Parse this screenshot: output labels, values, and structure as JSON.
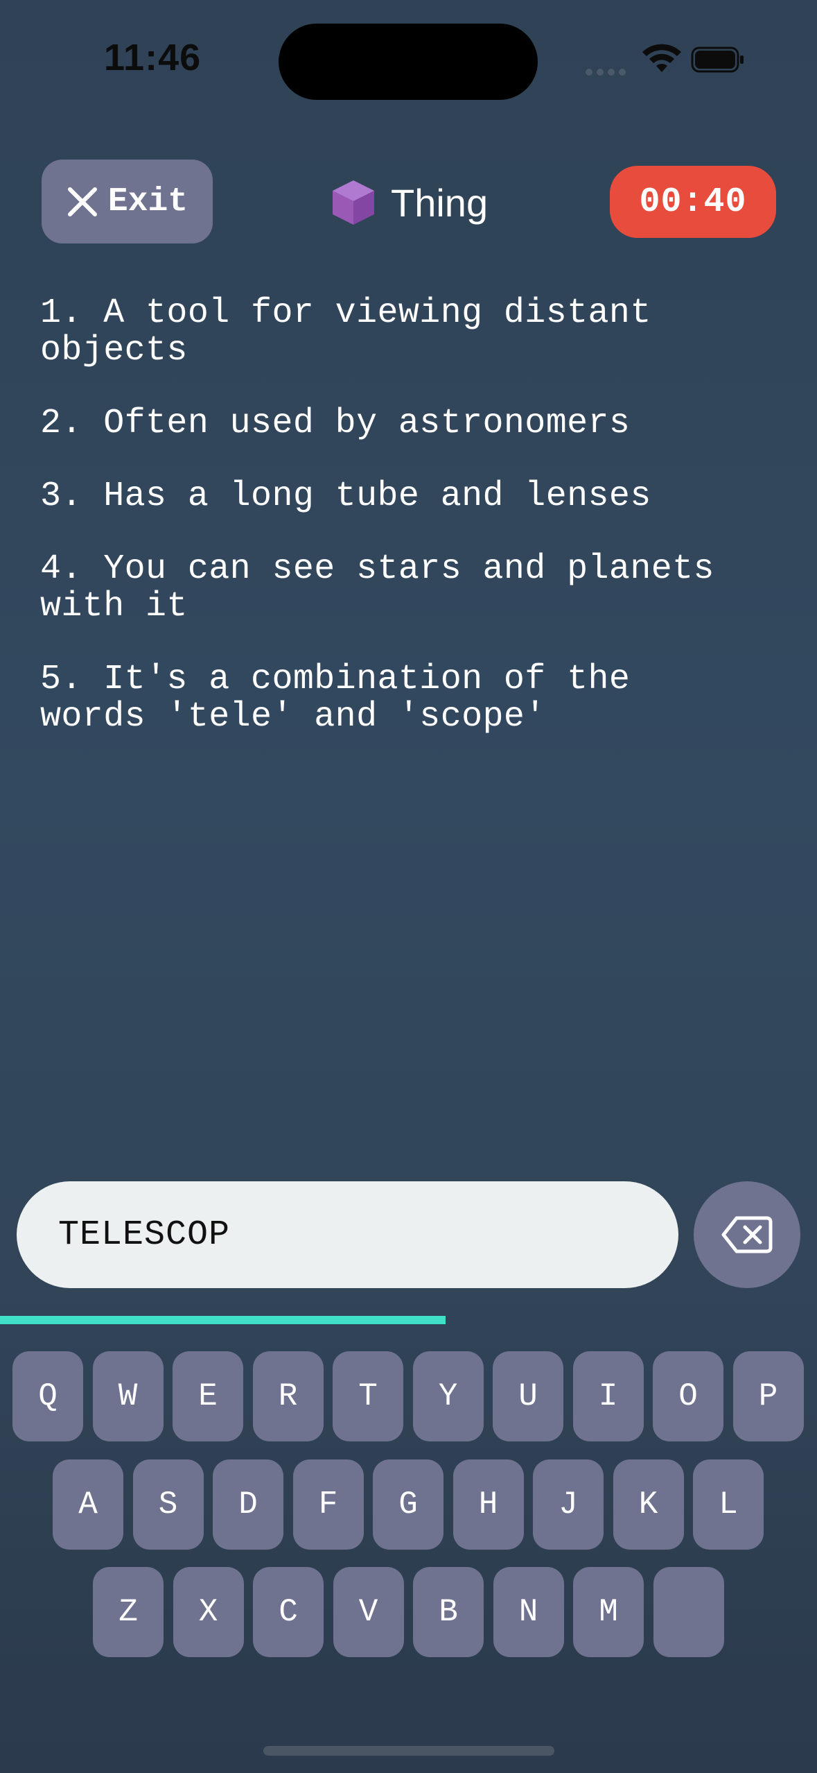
{
  "status_bar": {
    "time": "11:46"
  },
  "header": {
    "exit_label": "Exit",
    "category_label": "Thing",
    "timer": "00:40",
    "timer_color": "#e74c3c"
  },
  "clues": [
    "1. A tool for viewing distant\nobjects",
    "2. Often used by astronomers",
    "3. Has a long tube and lenses",
    "4. You can see stars and planets\nwith it",
    "5. It's a combination of the\nwords 'tele' and 'scope'"
  ],
  "answer": {
    "value": "TELESCOP"
  },
  "time_progress": 0.545,
  "colors": {
    "accent": "#40e0c8",
    "key": "#6f7390",
    "category_icon": "#9b59b6"
  },
  "keyboard": {
    "rows": [
      [
        "Q",
        "W",
        "E",
        "R",
        "T",
        "Y",
        "U",
        "I",
        "O",
        "P"
      ],
      [
        "A",
        "S",
        "D",
        "F",
        "G",
        "H",
        "J",
        "K",
        "L"
      ],
      [
        "Z",
        "X",
        "C",
        "V",
        "B",
        "N",
        "M",
        ""
      ]
    ]
  }
}
